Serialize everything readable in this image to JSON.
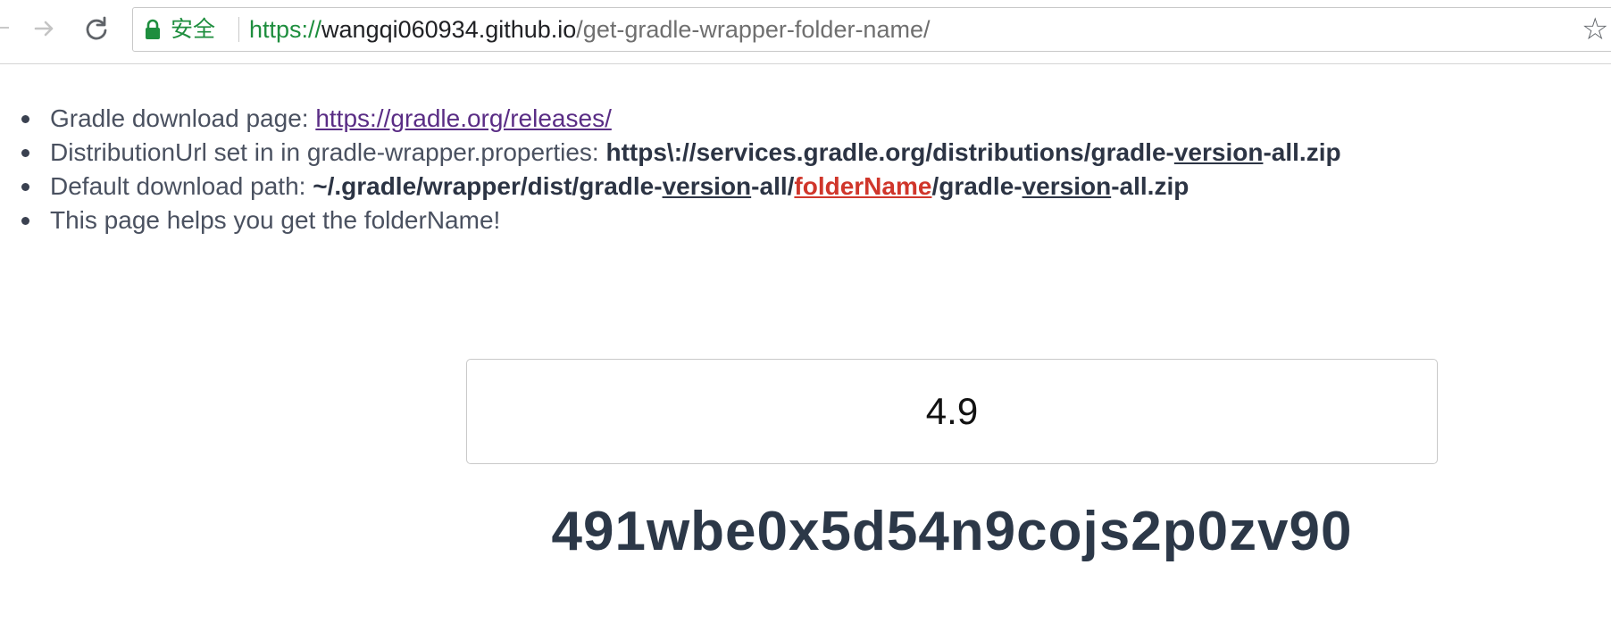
{
  "browser": {
    "secure_label": "安全",
    "url": {
      "scheme": "https://",
      "host": "wangqi060934.github.io",
      "path": "/get-gradle-wrapper-folder-name/"
    },
    "icons": {
      "forward": "forward-arrow-icon",
      "reload": "reload-icon",
      "lock": "lock-icon",
      "bookmark": "star-icon"
    },
    "colors": {
      "secure": "#1e8e3e"
    }
  },
  "page": {
    "items": [
      {
        "label": "Gradle download page: ",
        "link": "https://gradle.org/releases/"
      },
      {
        "label": "DistributionUrl set in in gradle-wrapper.properties: ",
        "code_pre": "https\\://services.gradle.org/distributions/gradle-",
        "code_var": "version",
        "code_post": "-all.zip"
      },
      {
        "label": "Default download path: ",
        "code_part1": "~/.gradle/wrapper/dist/gradle-",
        "code_var1": "version",
        "code_part2": "-all/",
        "code_folder": "folderName",
        "code_part3": "/gradle-",
        "code_var2": "version",
        "code_part4": "-all.zip"
      },
      {
        "label": "This page helps you get the folderName!"
      }
    ],
    "version_input_value": "4.9",
    "result": "491wbe0x5d54n9cojs2p0zv90",
    "colors": {
      "text": "#4a5160",
      "strong": "#2c3444",
      "link_visited": "#5a2d85",
      "folder_highlight": "#d0362b",
      "result": "#2c3848"
    }
  }
}
